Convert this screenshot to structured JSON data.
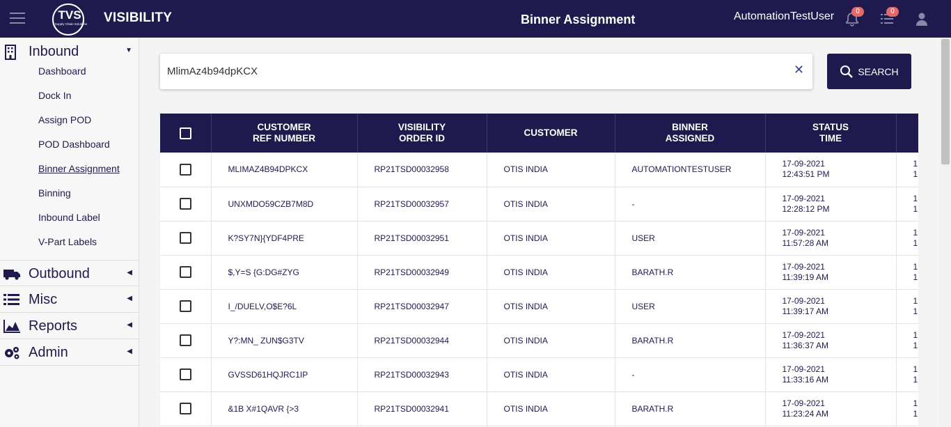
{
  "header": {
    "logo_text": "TVS",
    "logo_subtext": "Supply Chain Solutions",
    "brand": "VISIBILITY",
    "title": "Binner Assignment",
    "user": "AutomationTestUser",
    "notifications_count": "0",
    "tasks_count": "0"
  },
  "sidebar": {
    "inbound": {
      "label": "Inbound",
      "items": [
        {
          "label": "Dashboard"
        },
        {
          "label": "Dock In"
        },
        {
          "label": "Assign POD"
        },
        {
          "label": "POD Dashboard"
        },
        {
          "label": "Binner Assignment"
        },
        {
          "label": "Binning"
        },
        {
          "label": "Inbound Label"
        },
        {
          "label": "V-Part Labels"
        }
      ]
    },
    "outbound": {
      "label": "Outbound"
    },
    "misc": {
      "label": "Misc"
    },
    "reports": {
      "label": "Reports"
    },
    "admin": {
      "label": "Admin"
    }
  },
  "search": {
    "value": "MlimAz4b94dpKCX",
    "clear_icon": "close-icon",
    "button_label": "SEARCH"
  },
  "table": {
    "headers": {
      "customer_ref_1": "CUSTOMER",
      "customer_ref_2": "REF NUMBER",
      "order_1": "VISIBILITY",
      "order_2": "ORDER ID",
      "customer": "CUSTOMER",
      "binner_1": "BINNER",
      "binner_2": "ASSIGNED",
      "status_1": "STATUS",
      "status_2": "TIME"
    },
    "rows": [
      {
        "ref": "MLIMAZ4B94DPKCX",
        "order": "RP21TSD00032958",
        "customer": "OTIS INDIA",
        "binner": "AUTOMATIONTESTUSER",
        "date": "17-09-2021",
        "time": "12:43:51 PM",
        "extra1": "1",
        "extra2": "1"
      },
      {
        "ref": "UNXMDO59CZB7M8D",
        "order": "RP21TSD00032957",
        "customer": "OTIS INDIA",
        "binner": "-",
        "date": "17-09-2021",
        "time": "12:28:12 PM",
        "extra1": "1",
        "extra2": "1"
      },
      {
        "ref": "K?SY7N}{YDF4PRE",
        "order": "RP21TSD00032951",
        "customer": "OTIS INDIA",
        "binner": "USER",
        "date": "17-09-2021",
        "time": "11:57:28 AM",
        "extra1": "1",
        "extra2": "1"
      },
      {
        "ref": "$,Y=S {G:DG#ZYG",
        "order": "RP21TSD00032949",
        "customer": "OTIS INDIA",
        "binner": "BARATH.R",
        "date": "17-09-2021",
        "time": "11:39:19 AM",
        "extra1": "1",
        "extra2": "1"
      },
      {
        "ref": "I_/DUELV,O$E?6L",
        "order": "RP21TSD00032947",
        "customer": "OTIS INDIA",
        "binner": "USER",
        "date": "17-09-2021",
        "time": "11:39:17 AM",
        "extra1": "1",
        "extra2": "1"
      },
      {
        "ref": "Y?:MN_ ZUN$G3TV",
        "order": "RP21TSD00032944",
        "customer": "OTIS INDIA",
        "binner": "BARATH.R",
        "date": "17-09-2021",
        "time": "11:36:37 AM",
        "extra1": "1",
        "extra2": "1"
      },
      {
        "ref": "GVSSD61HQJRC1IP",
        "order": "RP21TSD00032943",
        "customer": "OTIS INDIA",
        "binner": "-",
        "date": "17-09-2021",
        "time": "11:33:16 AM",
        "extra1": "1",
        "extra2": "1"
      },
      {
        "ref": "&1B X#1QAVR {>3",
        "order": "RP21TSD00032941",
        "customer": "OTIS INDIA",
        "binner": "BARATH.R",
        "date": "17-09-2021",
        "time": "11:23:24 AM",
        "extra1": "1",
        "extra2": "1"
      }
    ]
  },
  "colors": {
    "primary": "#1f1a4d",
    "badge": "#e46a6a"
  }
}
